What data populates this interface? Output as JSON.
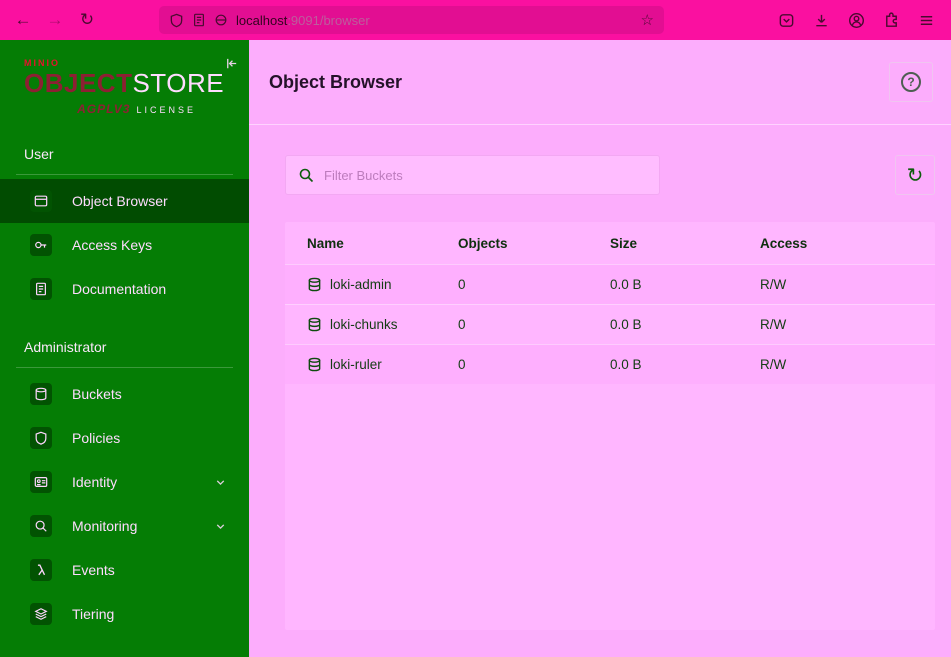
{
  "browser": {
    "url": {
      "host": "localhost",
      "path": ":9091/browser"
    }
  },
  "glyphs": {
    "back": "←",
    "forward": "→",
    "refresh": "↻",
    "star": "☆",
    "help": "?"
  },
  "sidebar": {
    "logo": {
      "brand": "MINIO",
      "word_bold": "OBJECT",
      "word_light": "STORE",
      "license_badge": "AGPLV3",
      "license_label": "LICENSE"
    },
    "sections": [
      {
        "label": "User",
        "items": [
          {
            "label": "Object Browser"
          },
          {
            "label": "Access Keys"
          },
          {
            "label": "Documentation"
          }
        ]
      },
      {
        "label": "Administrator",
        "items": [
          {
            "label": "Buckets"
          },
          {
            "label": "Policies"
          },
          {
            "label": "Identity"
          },
          {
            "label": "Monitoring"
          },
          {
            "label": "Events"
          },
          {
            "label": "Tiering"
          }
        ]
      }
    ]
  },
  "main": {
    "title": "Object Browser",
    "filter": {
      "placeholder": "Filter Buckets"
    },
    "table": {
      "columns": [
        "Name",
        "Objects",
        "Size",
        "Access"
      ],
      "rows": [
        {
          "name": "loki-admin",
          "objects": "0",
          "size": "0.0 B",
          "access": "R/W"
        },
        {
          "name": "loki-chunks",
          "objects": "0",
          "size": "0.0 B",
          "access": "R/W"
        },
        {
          "name": "loki-ruler",
          "objects": "0",
          "size": "0.0 B",
          "access": "R/W"
        }
      ]
    }
  },
  "colors": {
    "chrome_bg": "#fa10a0",
    "chrome_ink": "#4a0a30",
    "urlbar_bg": "#e20e92",
    "url_host": "#33031f",
    "url_muted": "#bc5d9c",
    "sidebar_bg": "#057d05",
    "sidebar_selected": "#014c01",
    "sidebar_ink": "#ffdcff",
    "badge_bg": "#025302",
    "logo_red": "#e8112d",
    "logo_maroon": "#8d2033",
    "main_bg": "#fcadfc",
    "card_bg": "#ffb6ff",
    "row_alt": "#feaffe",
    "divider_pink": "#ffd2ff",
    "table_ink": "#143c14",
    "table_head_ink": "#0f2f0f",
    "accent_green": "#0d5c0d",
    "button_border": "#f0c4f0",
    "input_bg": "#ffbdff",
    "input_border": "#f3a8f3",
    "placeholder": "#bd7cbd",
    "title_ink": "#241229"
  }
}
